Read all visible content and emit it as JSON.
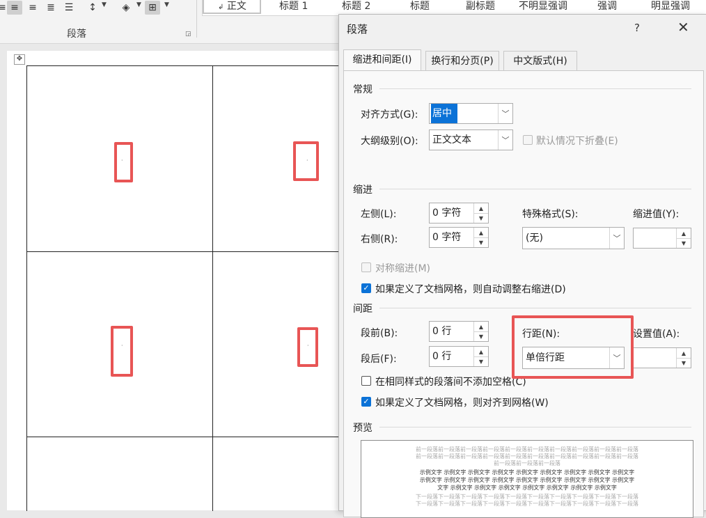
{
  "ribbon": {
    "group_label": "段落",
    "styles": [
      {
        "name": "正文",
        "mark": "↲"
      },
      {
        "name": "标题 1"
      },
      {
        "name": "标题 2"
      },
      {
        "name": "标题"
      },
      {
        "name": "副标题"
      },
      {
        "name": "不明显强调"
      },
      {
        "name": "强调"
      },
      {
        "name": "明显强调"
      }
    ]
  },
  "dialog": {
    "title": "段落",
    "help": "?",
    "close": "✕",
    "tabs": [
      "缩进和间距(I)",
      "换行和分页(P)",
      "中文版式(H)"
    ],
    "general": {
      "title": "常规",
      "alignment_label": "对齐方式(G):",
      "alignment_value": "居中",
      "outline_label": "大纲级别(O):",
      "outline_value": "正文文本",
      "collapse_label": "默认情况下折叠(E)"
    },
    "indent": {
      "title": "缩进",
      "left_label": "左侧(L):",
      "left_value": "0 字符",
      "right_label": "右侧(R):",
      "right_value": "0 字符",
      "special_label": "特殊格式(S):",
      "special_value": "(无)",
      "by_label": "缩进值(Y):",
      "by_value": "",
      "mirror_label": "对称缩进(M)",
      "auto_label": "如果定义了文档网格，则自动调整右缩进(D)"
    },
    "spacing": {
      "title": "间距",
      "before_label": "段前(B):",
      "before_value": "0 行",
      "after_label": "段后(F):",
      "after_value": "0 行",
      "line_label": "行距(N):",
      "line_value": "单倍行距",
      "at_label": "设置值(A):",
      "at_value": "",
      "no_space_label": "在相同样式的段落间不添加空格(C)",
      "snap_label": "如果定义了文档网格，则对齐到网格(W)"
    },
    "preview": {
      "title": "预览",
      "prev_line": "前一段落前一段落前一段落前一段落前一段落前一段落前一段落前一段落前一段落前一段落",
      "prev_last": "前一段落前一段落前一段落",
      "sample": "示例文字 示例文字 示例文字 示例文字 示例文字 示例文字 示例文字 示例文字 示例文字",
      "sample_last": "文字 示例文字 示例文字 示例文字 示例文字 示例文字 示例文字 示例文字",
      "next_line": "下一段落下一段落下一段落下一段落下一段落下一段落下一段落下一段落下一段落下一段落"
    }
  },
  "colors": {
    "accent": "#0b72d7",
    "highlight_box": "#e85555"
  }
}
